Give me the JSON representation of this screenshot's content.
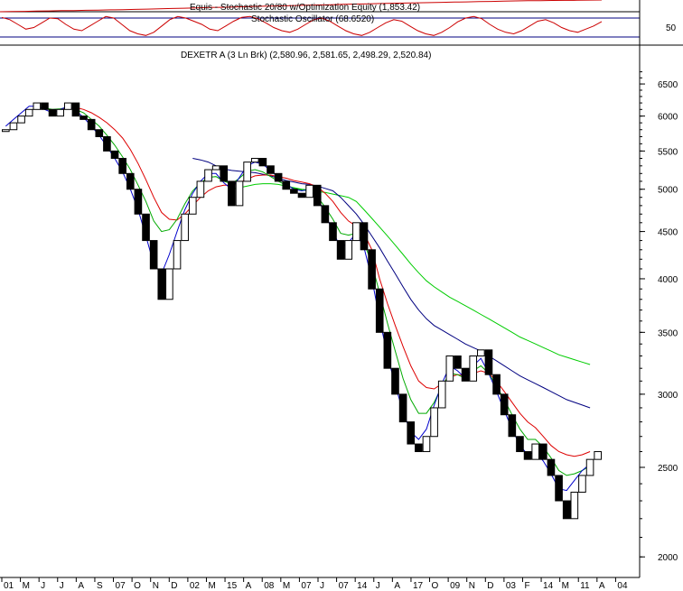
{
  "window": {
    "equity_title": "Equis - Stochastic 20/80  w/Optimization Equity (1,853.42)",
    "stoch_title": "Stochastic Oscillator (68.6520)",
    "price_title": "DEXETR A (3 Ln Brk)  (2,580.96, 2,581.65, 2,498.29, 2,520.84)",
    "stoch_axis_label": "50"
  },
  "chart_data": {
    "type": "line",
    "chart_style": "three-line-break",
    "y_scale": "log",
    "ylim": [
      1900,
      6800
    ],
    "y_ticks": [
      6500,
      6000,
      5500,
      5000,
      4500,
      4000,
      3500,
      3000,
      2500,
      2000
    ],
    "x_tick_labels": [
      "01",
      "M",
      "J",
      "J",
      "A",
      "S",
      "07",
      "O",
      "N",
      "D",
      "02",
      "M",
      "15",
      "A",
      "08",
      "M",
      "07",
      "J",
      "07",
      "14",
      "J",
      "A",
      "17",
      "O",
      "09",
      "N",
      "D",
      "03",
      "F",
      "14",
      "M",
      "11",
      "A",
      "04"
    ],
    "stochastic_levels": [
      80,
      50,
      20
    ],
    "stochastic_value": 68.652,
    "equity_value": 1853.42,
    "last_bar": {
      "open": 2580.96,
      "high": 2581.65,
      "low": 2498.29,
      "close": 2520.84
    },
    "colors": {
      "up_brick": "#ffffff",
      "down_brick": "#000000",
      "ma_fast": "#0000cc",
      "ma_mid": "#00aa00",
      "ma_red": "#dd0000",
      "ma_slow_blue": "#000080",
      "ma_slow_green": "#00cc00",
      "stoch_line": "#cc0000",
      "grid": "#000080"
    },
    "bricks": [
      [
        5800,
        5800
      ],
      [
        5800,
        5900
      ],
      [
        5900,
        6000
      ],
      [
        6000,
        6100
      ],
      [
        6100,
        6200
      ],
      [
        6200,
        6100
      ],
      [
        6100,
        6000
      ],
      [
        6000,
        6100
      ],
      [
        6100,
        6200
      ],
      [
        6200,
        6000
      ],
      [
        6000,
        5950
      ],
      [
        5950,
        5800
      ],
      [
        5800,
        5700
      ],
      [
        5700,
        5500
      ],
      [
        5500,
        5400
      ],
      [
        5400,
        5200
      ],
      [
        5200,
        5000
      ],
      [
        5000,
        4700
      ],
      [
        4700,
        4400
      ],
      [
        4400,
        4100
      ],
      [
        4100,
        3800
      ],
      [
        3800,
        4100
      ],
      [
        4100,
        4400
      ],
      [
        4400,
        4700
      ],
      [
        4700,
        4900
      ],
      [
        4900,
        5100
      ],
      [
        5100,
        5250
      ],
      [
        5250,
        5300
      ],
      [
        5300,
        5100
      ],
      [
        5100,
        4800
      ],
      [
        4800,
        5100
      ],
      [
        5100,
        5350
      ],
      [
        5350,
        5400
      ],
      [
        5400,
        5300
      ],
      [
        5300,
        5200
      ],
      [
        5200,
        5100
      ],
      [
        5100,
        5000
      ],
      [
        5000,
        4950
      ],
      [
        4950,
        4900
      ],
      [
        4900,
        5050
      ],
      [
        5050,
        4800
      ],
      [
        4800,
        4600
      ],
      [
        4600,
        4400
      ],
      [
        4400,
        4200
      ],
      [
        4200,
        4400
      ],
      [
        4400,
        4600
      ],
      [
        4600,
        4300
      ],
      [
        4300,
        3900
      ],
      [
        3900,
        3500
      ],
      [
        3500,
        3200
      ],
      [
        3200,
        3000
      ],
      [
        3000,
        2800
      ],
      [
        2800,
        2650
      ],
      [
        2650,
        2600
      ],
      [
        2600,
        2700
      ],
      [
        2700,
        2900
      ],
      [
        2900,
        3100
      ],
      [
        3100,
        3300
      ],
      [
        3300,
        3200
      ],
      [
        3200,
        3100
      ],
      [
        3100,
        3300
      ],
      [
        3300,
        3350
      ],
      [
        3350,
        3150
      ],
      [
        3150,
        3000
      ],
      [
        3000,
        2850
      ],
      [
        2850,
        2700
      ],
      [
        2700,
        2600
      ],
      [
        2600,
        2550
      ],
      [
        2550,
        2650
      ],
      [
        2650,
        2550
      ],
      [
        2550,
        2450
      ],
      [
        2450,
        2300
      ],
      [
        2300,
        2200
      ],
      [
        2200,
        2350
      ],
      [
        2350,
        2450
      ],
      [
        2450,
        2550
      ],
      [
        2550,
        2600
      ]
    ],
    "ma_fast": [
      5850,
      5950,
      6050,
      6150,
      6150,
      6100,
      6050,
      6100,
      6150,
      6080,
      5980,
      5850,
      5720,
      5560,
      5400,
      5220,
      5000,
      4750,
      4450,
      4150,
      4050,
      4250,
      4500,
      4750,
      4950,
      5100,
      5200,
      5200,
      5080,
      5000,
      5150,
      5300,
      5350,
      5320,
      5240,
      5150,
      5060,
      5000,
      4980,
      5000,
      4900,
      4700,
      4500,
      4320,
      4380,
      4480,
      4320,
      4000,
      3620,
      3300,
      3070,
      2870,
      2730,
      2680,
      2750,
      2920,
      3080,
      3220,
      3180,
      3120,
      3220,
      3280,
      3160,
      3020,
      2880,
      2750,
      2640,
      2580,
      2600,
      2540,
      2460,
      2370,
      2360,
      2420,
      2480,
      2520
    ],
    "ma_mid": [
      null,
      null,
      null,
      null,
      null,
      6120,
      6100,
      6110,
      6130,
      6100,
      6050,
      5950,
      5850,
      5720,
      5580,
      5420,
      5250,
      5050,
      4850,
      4620,
      4500,
      4520,
      4640,
      4820,
      4980,
      5080,
      5150,
      5160,
      5100,
      5070,
      5140,
      5230,
      5250,
      5220,
      5160,
      5100,
      5050,
      5010,
      4990,
      4980,
      4910,
      4780,
      4640,
      4480,
      4460,
      4480,
      4380,
      4150,
      3860,
      3580,
      3340,
      3120,
      2960,
      2860,
      2860,
      2940,
      3060,
      3160,
      3150,
      3120,
      3180,
      3220,
      3160,
      3060,
      2960,
      2850,
      2750,
      2680,
      2680,
      2630,
      2560,
      2480,
      2450,
      2460,
      2480,
      2510
    ],
    "ma_red": [
      null,
      null,
      null,
      null,
      null,
      null,
      null,
      6100,
      6120,
      6130,
      6100,
      6050,
      5980,
      5900,
      5800,
      5680,
      5520,
      5330,
      5120,
      4900,
      4720,
      4640,
      4630,
      4700,
      4800,
      4900,
      4980,
      5030,
      5050,
      5050,
      5080,
      5130,
      5170,
      5180,
      5180,
      5160,
      5140,
      5110,
      5090,
      5070,
      5030,
      4950,
      4850,
      4720,
      4620,
      4560,
      4480,
      4300,
      4000,
      3760,
      3560,
      3380,
      3220,
      3100,
      3050,
      3040,
      3080,
      3130,
      3150,
      3140,
      3160,
      3180,
      3160,
      3100,
      3020,
      2940,
      2860,
      2800,
      2760,
      2700,
      2640,
      2600,
      2580,
      2570,
      2580,
      2600
    ],
    "ma_slow_blue": [
      null,
      null,
      null,
      null,
      null,
      null,
      null,
      null,
      null,
      null,
      null,
      null,
      null,
      null,
      null,
      null,
      null,
      null,
      null,
      null,
      null,
      null,
      null,
      null,
      5400,
      5380,
      5350,
      5300,
      5260,
      5240,
      5230,
      5220,
      5210,
      5190,
      5170,
      5140,
      5110,
      5090,
      5070,
      5060,
      5040,
      5010,
      4980,
      4900,
      4800,
      4700,
      4580,
      4450,
      4320,
      4180,
      4050,
      3920,
      3800,
      3700,
      3620,
      3560,
      3520,
      3480,
      3440,
      3400,
      3370,
      3340,
      3300,
      3260,
      3220,
      3180,
      3140,
      3110,
      3080,
      3050,
      3020,
      2990,
      2960,
      2940,
      2920,
      2900
    ],
    "ma_slow_green": [
      null,
      null,
      null,
      null,
      null,
      null,
      null,
      null,
      null,
      null,
      null,
      null,
      null,
      null,
      null,
      null,
      null,
      null,
      null,
      null,
      null,
      null,
      null,
      null,
      null,
      null,
      null,
      null,
      null,
      5000,
      5020,
      5040,
      5060,
      5070,
      5070,
      5060,
      5040,
      5020,
      5000,
      4990,
      4970,
      4960,
      4940,
      4920,
      4900,
      4850,
      4750,
      4650,
      4550,
      4450,
      4350,
      4250,
      4150,
      4060,
      3980,
      3920,
      3870,
      3820,
      3780,
      3740,
      3700,
      3660,
      3620,
      3580,
      3540,
      3500,
      3460,
      3430,
      3400,
      3370,
      3340,
      3310,
      3290,
      3270,
      3250,
      3230
    ],
    "stochastic": [
      82,
      75,
      60,
      45,
      50,
      65,
      80,
      78,
      60,
      45,
      40,
      55,
      70,
      85,
      80,
      60,
      40,
      30,
      25,
      35,
      55,
      75,
      85,
      80,
      70,
      60,
      45,
      40,
      55,
      70,
      82,
      85,
      78,
      65,
      50,
      40,
      35,
      45,
      60,
      75,
      80,
      70,
      55,
      40,
      30,
      25,
      35,
      50,
      65,
      75,
      70,
      55,
      40,
      30,
      25,
      35,
      50,
      68,
      80,
      85,
      78,
      60,
      45,
      35,
      30,
      40,
      55,
      70,
      75,
      65,
      50,
      40,
      35,
      45,
      55,
      69
    ],
    "equity": [
      0.0,
      0.02,
      0.03,
      0.05,
      0.07,
      0.09,
      0.1,
      0.12,
      0.14,
      0.16,
      0.18,
      0.2,
      0.22,
      0.25,
      0.28,
      0.3,
      0.33,
      0.36,
      0.38,
      0.4,
      0.43,
      0.46,
      0.48,
      0.5,
      0.53,
      0.56,
      0.58,
      0.6,
      0.63,
      0.65,
      0.68,
      0.7,
      0.72,
      0.74,
      0.76,
      0.78,
      0.8,
      0.82,
      0.84,
      0.86,
      0.88,
      0.9,
      0.92,
      0.94,
      0.95,
      0.96,
      0.97,
      0.98,
      0.99,
      1.0
    ]
  }
}
